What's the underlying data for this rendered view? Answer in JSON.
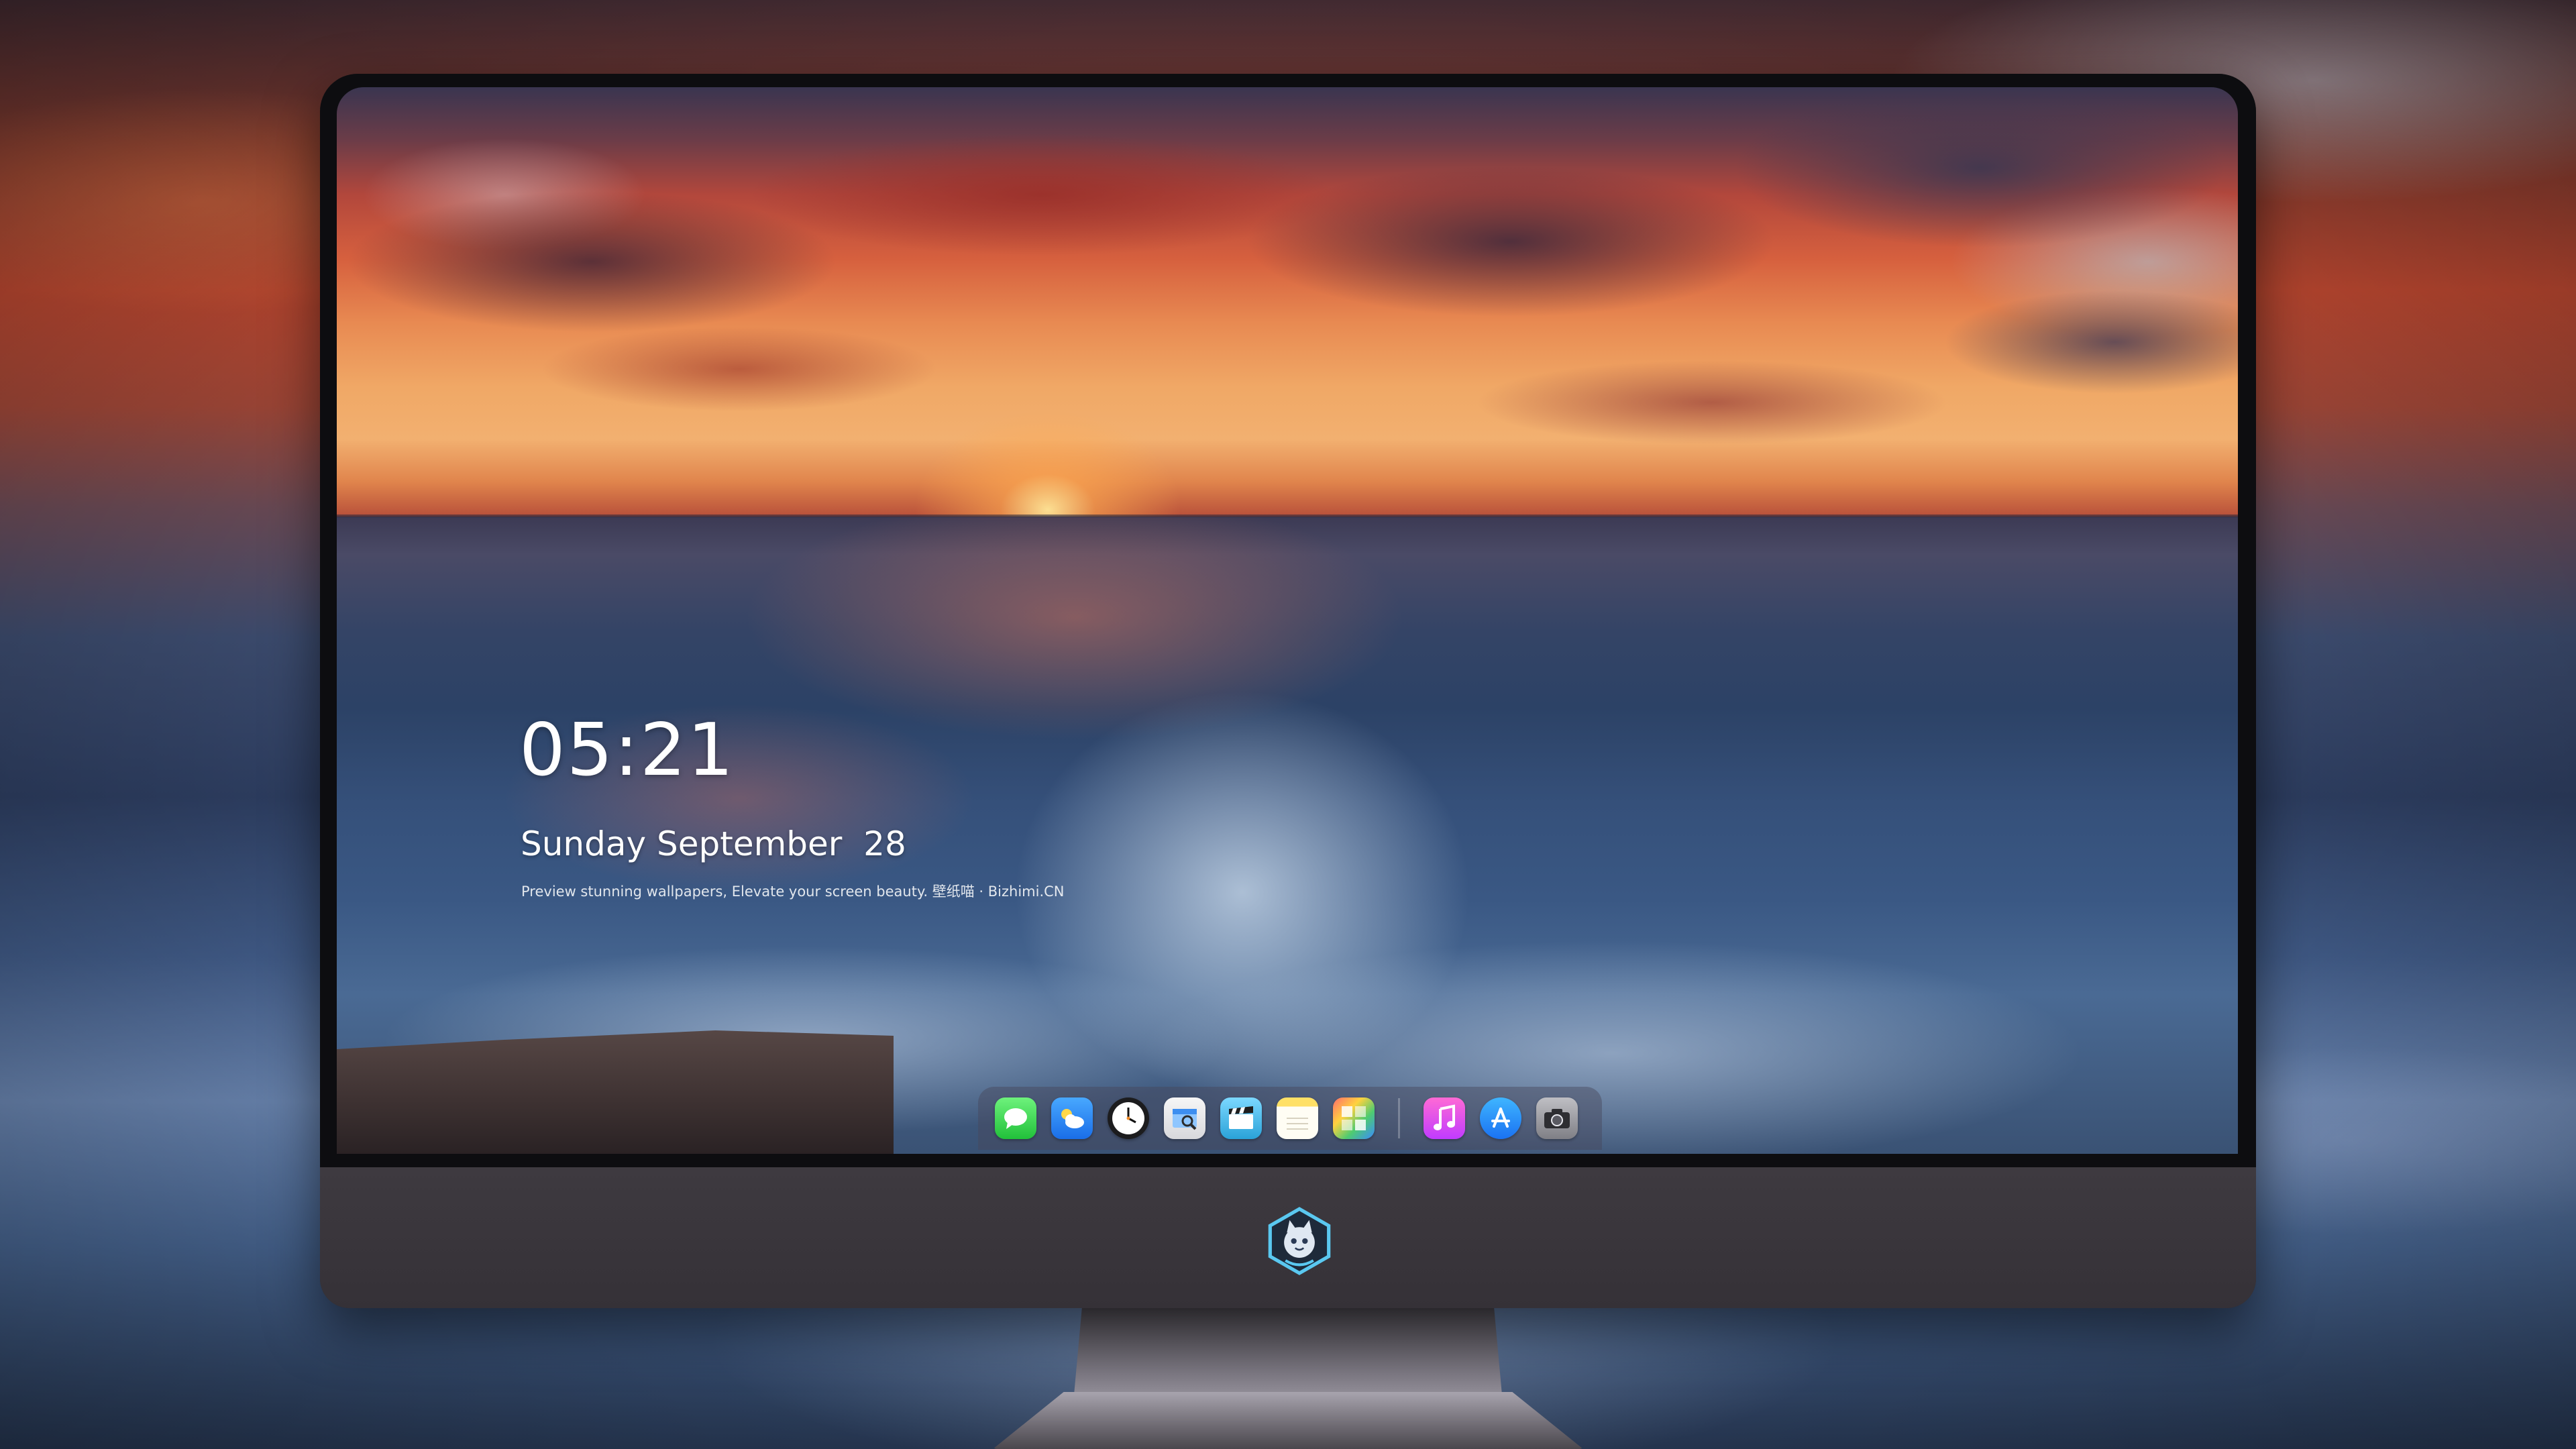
{
  "lock_screen": {
    "time": "05:21",
    "date": "Sunday September  28",
    "tagline": "Preview stunning wallpapers, Elevate your screen beauty. 壁纸喵 · Bizhimi.CN"
  },
  "dock": {
    "apps": [
      {
        "name": "Messages",
        "icon": "message-bubble-icon"
      },
      {
        "name": "Weather",
        "icon": "cloud-sun-icon"
      },
      {
        "name": "Clock",
        "icon": "clock-icon"
      },
      {
        "name": "Preview",
        "icon": "preview-icon"
      },
      {
        "name": "Clips",
        "icon": "clapperboard-icon"
      },
      {
        "name": "Notes",
        "icon": "notes-icon"
      },
      {
        "name": "Photo Booth",
        "icon": "photo-grid-icon"
      },
      {
        "name": "Music",
        "icon": "music-note-icon"
      },
      {
        "name": "App Store",
        "icon": "app-store-icon"
      },
      {
        "name": "Camera",
        "icon": "camera-icon"
      }
    ]
  },
  "colors": {
    "bezel": "#0d0d10",
    "chin": "#3a363c",
    "text": "#ffffff"
  }
}
